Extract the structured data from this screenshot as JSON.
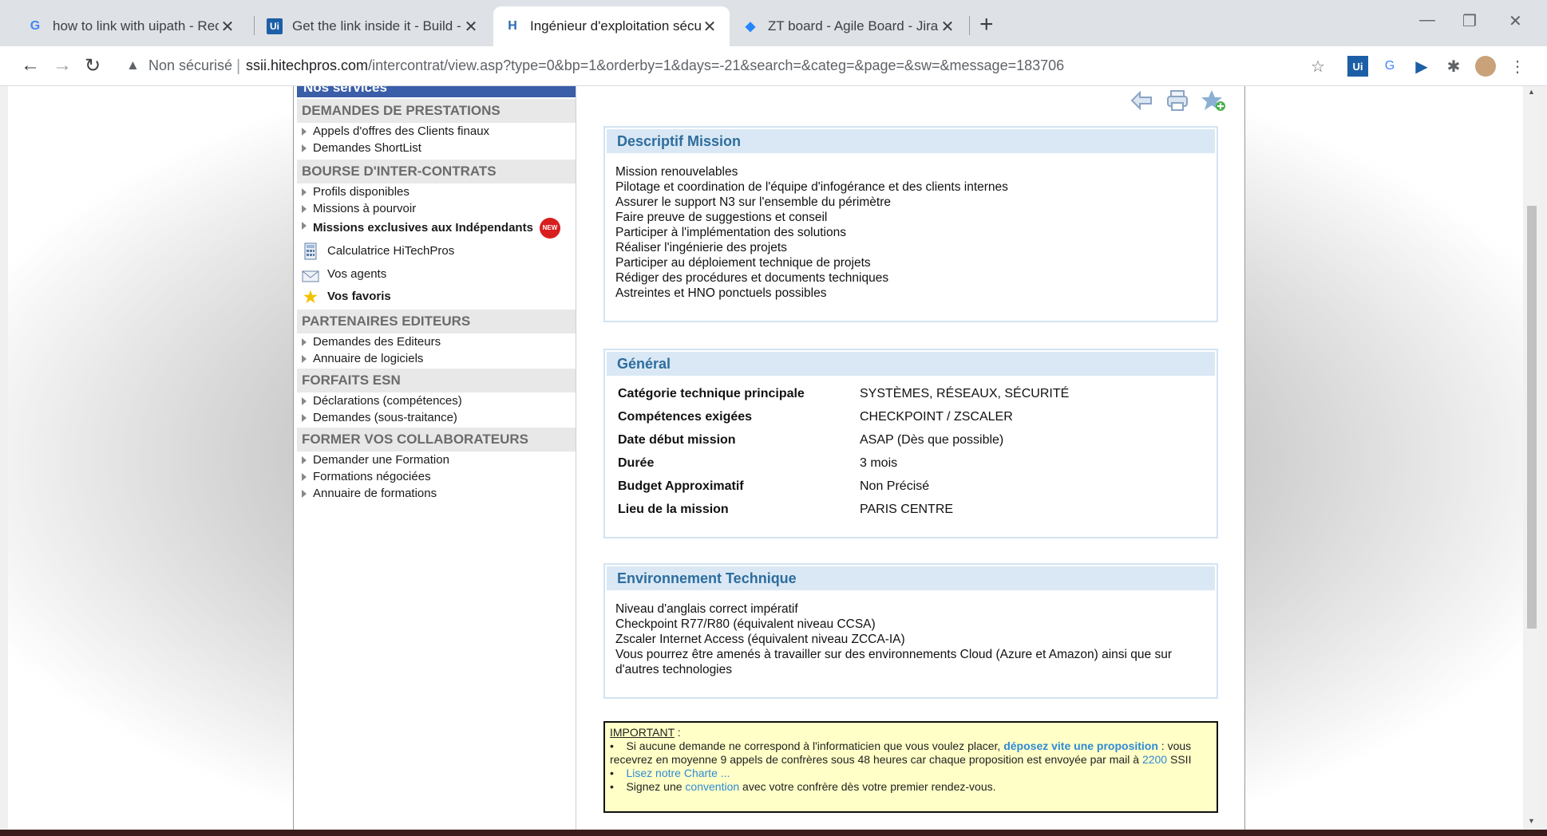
{
  "browser": {
    "tabs": [
      {
        "title": "how to link with uipath - Recherc",
        "favicon": "G"
      },
      {
        "title": "Get the link inside it - Build - UiP",
        "favicon": "Ui"
      },
      {
        "title": "Ingénieur d'exploitation sécurité",
        "favicon": "H"
      },
      {
        "title": "ZT board - Agile Board - Jira",
        "favicon": "◆"
      }
    ],
    "security_label": "Non sécurisé",
    "url_host": "ssii.hitechpros.com",
    "url_path": "/intercontrat/view.asp?type=0&bp=1&orderby=1&days=-21&search=&categ=&page=&sw=&message=183706"
  },
  "sidebar": {
    "services_title": "Nos services",
    "sections": {
      "prestations": {
        "title": "DEMANDES DE PRESTATIONS",
        "items": [
          "Appels d'offres des Clients finaux",
          "Demandes ShortList"
        ]
      },
      "bourse": {
        "title": "BOURSE D'INTER-CONTRATS",
        "items": [
          "Profils disponibles",
          "Missions à pourvoir",
          "Missions exclusives aux Indépendants"
        ]
      },
      "partenaires": {
        "title": "PARTENAIRES EDITEURS",
        "items": [
          "Demandes des Editeurs",
          "Annuaire de logiciels"
        ]
      },
      "forfaits": {
        "title": "FORFAITS ESN",
        "items": [
          "Déclarations (compétences)",
          "Demandes (sous-traitance)"
        ]
      },
      "former": {
        "title": "FORMER VOS COLLABORATEURS",
        "items": [
          "Demander une Formation",
          "Formations négociées",
          "Annuaire de formations"
        ]
      }
    },
    "new_badge": "NEW",
    "tools": [
      "Calculatrice HiTechPros",
      "Vos agents",
      "Vos favoris"
    ]
  },
  "mission": {
    "descriptif_title": "Descriptif Mission",
    "descriptif_lines": [
      "Mission renouvelables",
      "Pilotage et coordination de l'équipe d'infogérance et des clients internes",
      "Assurer le support N3 sur l'ensemble du périmètre",
      "Faire preuve de suggestions et conseil",
      "Participer à l'implémentation des solutions",
      "Réaliser l'ingénierie des projets",
      "Participer au déploiement technique de projets",
      "Rédiger des procédures et documents techniques",
      "Astreintes et HNO ponctuels possibles"
    ],
    "general_title": "Général",
    "general_rows": [
      {
        "label": "Catégorie technique principale",
        "value": "SYSTÈMES, RÉSEAUX, SÉCURITÉ"
      },
      {
        "label": "Compétences exigées",
        "value": "CHECKPOINT / ZSCALER"
      },
      {
        "label": "Date début mission",
        "value": "ASAP (Dès que possible)"
      },
      {
        "label": "Durée",
        "value": "3 mois"
      },
      {
        "label": "Budget Approximatif",
        "value": "Non Précisé"
      },
      {
        "label": "Lieu de la mission",
        "value": "PARIS CENTRE"
      }
    ],
    "env_title": "Environnement Technique",
    "env_lines": [
      "Niveau d'anglais correct impératif",
      "Checkpoint R77/R80 (équivalent niveau CCSA)",
      "Zscaler Internet Access (équivalent niveau ZCCA-IA)",
      "Vous pourrez être amenés à travailler sur des environnements Cloud (Azure et Amazon) ainsi que sur d'autres technologies"
    ]
  },
  "important": {
    "label": "IMPORTANT",
    "colon": " :",
    "b1_pre": "Si aucune demande ne correspond à l'informaticien que vous voulez placer, ",
    "b1_link": "déposez vite une proposition",
    "b1_post": " : vous recevrez en moyenne 9 appels de confrères sous 48 heures car chaque proposition est envoyée par mail à ",
    "b1_num": "2200",
    "b1_end": " SSII",
    "b2_link": "Lisez notre Charte ...",
    "b3_pre": "Signez une ",
    "b3_link": "convention",
    "b3_post": " avec votre confrère dès votre premier rendez-vous."
  },
  "colors": {
    "accent": "#2e6d9e",
    "section_head": "#d9e8f4",
    "important_bg": "#ffffc7"
  }
}
